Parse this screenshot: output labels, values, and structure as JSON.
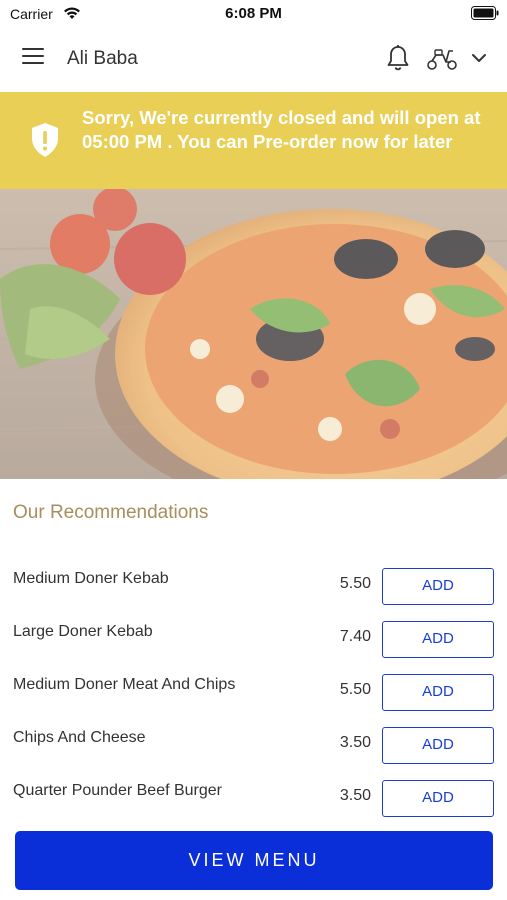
{
  "status_bar": {
    "carrier": "Carrier",
    "time": "6:08 PM"
  },
  "header": {
    "title": "Ali Baba",
    "icons": [
      "menu-icon",
      "bell-icon",
      "scooter-icon",
      "chevron-down-icon"
    ]
  },
  "banner": {
    "text": "Sorry, We're currently closed and will open at 05:00 PM . You can Pre-order now for later",
    "color": "#e9cf55",
    "icon": "shield-alert-icon"
  },
  "recommendations": {
    "title": "Our Recommendations",
    "items": [
      {
        "name": "Medium Doner Kebab",
        "price": "5.50",
        "add_label": "ADD"
      },
      {
        "name": "Large Doner Kebab",
        "price": "7.40",
        "add_label": "ADD"
      },
      {
        "name": "Medium Doner Meat And Chips",
        "price": "5.50",
        "add_label": "ADD"
      },
      {
        "name": "Chips And Cheese",
        "price": "3.50",
        "add_label": "ADD"
      },
      {
        "name": "Quarter Pounder Beef Burger",
        "price": "3.50",
        "add_label": "ADD"
      }
    ]
  },
  "footer": {
    "view_menu_label": "VIEW MENU",
    "accent": "#0a2fd8"
  }
}
